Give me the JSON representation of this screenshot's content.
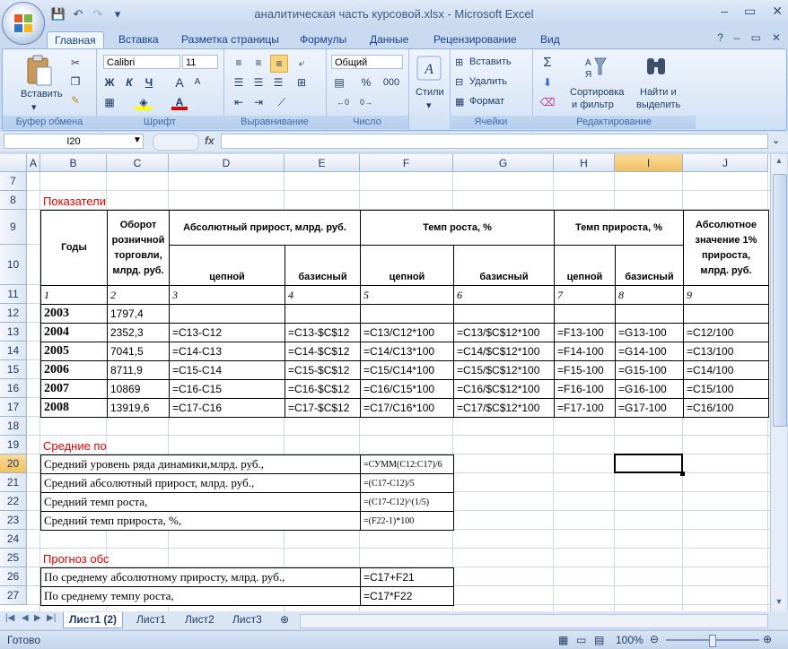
{
  "window": {
    "title": "аналитическая часть курсовой.xlsx - Microsoft Excel",
    "minimize": "–",
    "restore": "▭",
    "close": "✕"
  },
  "qat": {
    "save": "💾",
    "undo": "↶",
    "redo": "↷",
    "more": "▾"
  },
  "tabs": [
    "Главная",
    "Вставка",
    "Разметка страницы",
    "Формулы",
    "Данные",
    "Рецензирование",
    "Вид"
  ],
  "tabs_right": {
    "help": "?",
    "min": "–",
    "restore": "▭",
    "close": "✕"
  },
  "ribbon": {
    "clipboard": {
      "paste": "Вставить",
      "label": "Буфер обмена"
    },
    "font": {
      "name": "Calibri",
      "size": "11",
      "label": "Шрифт",
      "bold": "Ж",
      "italic": "К",
      "underline": "Ч",
      "grow": "A",
      "shrink": "A"
    },
    "align": {
      "label": "Выравнивание"
    },
    "number": {
      "format": "Общий",
      "percent": "%",
      "thousands": "000",
      "label": "Число"
    },
    "styles": {
      "label": "Стили"
    },
    "cells": {
      "insert": "Вставить",
      "delete": "Удалить",
      "format": "Формат",
      "label": "Ячейки"
    },
    "editing": {
      "sort": "Сортировка",
      "sort2": "и фильтр",
      "find": "Найти и",
      "find2": "выделить",
      "label": "Редактирование",
      "sigma": "Σ"
    }
  },
  "formula_bar": {
    "name_box": "I20",
    "fx": "fx",
    "formula": ""
  },
  "columns": [
    "A",
    "B",
    "C",
    "D",
    "E",
    "F",
    "G",
    "H",
    "I",
    "J"
  ],
  "rows": [
    "7",
    "8",
    "9",
    "10",
    "11",
    "12",
    "13",
    "14",
    "15",
    "16",
    "17",
    "18",
    "19",
    "20",
    "21",
    "22",
    "23",
    "24",
    "25",
    "26",
    "27"
  ],
  "sheet": {
    "r8": "Показатели",
    "h_years": "Годы",
    "h_turnover": "Оборот розничной торговли, млрд. руб.",
    "h_abs": "Абсолютный прирост, млрд. руб.",
    "h_growth": "Темп роста, %",
    "h_increase": "Темп прироста, %",
    "h_one_pct": "Абсолютное значение 1% прироста, млрд. руб.",
    "h_chain1": "цепной",
    "h_base1": "базисный",
    "h_chain2": "цепной",
    "h_base2": "базисный",
    "h_chain3": "цепной",
    "h_base3": "базисный",
    "nums": [
      "1",
      "2",
      "3",
      "4",
      "5",
      "6",
      "7",
      "8",
      "9"
    ],
    "data": [
      [
        "2003",
        "1797,4",
        "",
        "",
        "",
        "",
        "",
        "",
        ""
      ],
      [
        "2004",
        "2352,3",
        "=C13-C12",
        "=C13-$C$12",
        "=C13/C12*100",
        "=C13/$C$12*100",
        "=F13-100",
        "=G13-100",
        "=C12/100"
      ],
      [
        "2005",
        "7041,5",
        "=C14-C13",
        "=C14-$C$12",
        "=C14/C13*100",
        "=C14/$C$12*100",
        "=F14-100",
        "=G14-100",
        "=C13/100"
      ],
      [
        "2006",
        "8711,9",
        "=C15-C14",
        "=C15-$C$12",
        "=C15/C14*100",
        "=C15/$C$12*100",
        "=F15-100",
        "=G15-100",
        "=C14/100"
      ],
      [
        "2007",
        "10869",
        "=C16-C15",
        "=C16-$C$12",
        "=C16/C15*100",
        "=C16/$C$12*100",
        "=F16-100",
        "=G16-100",
        "=C15/100"
      ],
      [
        "2008",
        "13919,6",
        "=C17-C16",
        "=C17-$C$12",
        "=C17/C16*100",
        "=C17/$C$12*100",
        "=F17-100",
        "=G17-100",
        "=C16/100"
      ]
    ],
    "r19": "Средние по",
    "avg": [
      [
        "Средний уровень ряда динамики,млрд. руб.,",
        "=СУММ(C12:C17)/6"
      ],
      [
        "Средний абсолютный прирост, млрд. руб.,",
        "=(C17-C12)/5"
      ],
      [
        "Средний темп роста,",
        "=(C17-C12)^(1/5)"
      ],
      [
        "Средний темп прироста, %,",
        "=(F22-1)*100"
      ]
    ],
    "r25": "Прогноз обс",
    "forecast": [
      [
        "По среднему абсолютному приросту, млрд. руб.,",
        "=C17+F21"
      ],
      [
        "По среднему темпу роста,",
        "=C17*F22"
      ]
    ]
  },
  "sheet_tabs": [
    "Лист1 (2)",
    "Лист1",
    "Лист2",
    "Лист3"
  ],
  "status": {
    "ready": "Готово",
    "zoom": "100%"
  }
}
